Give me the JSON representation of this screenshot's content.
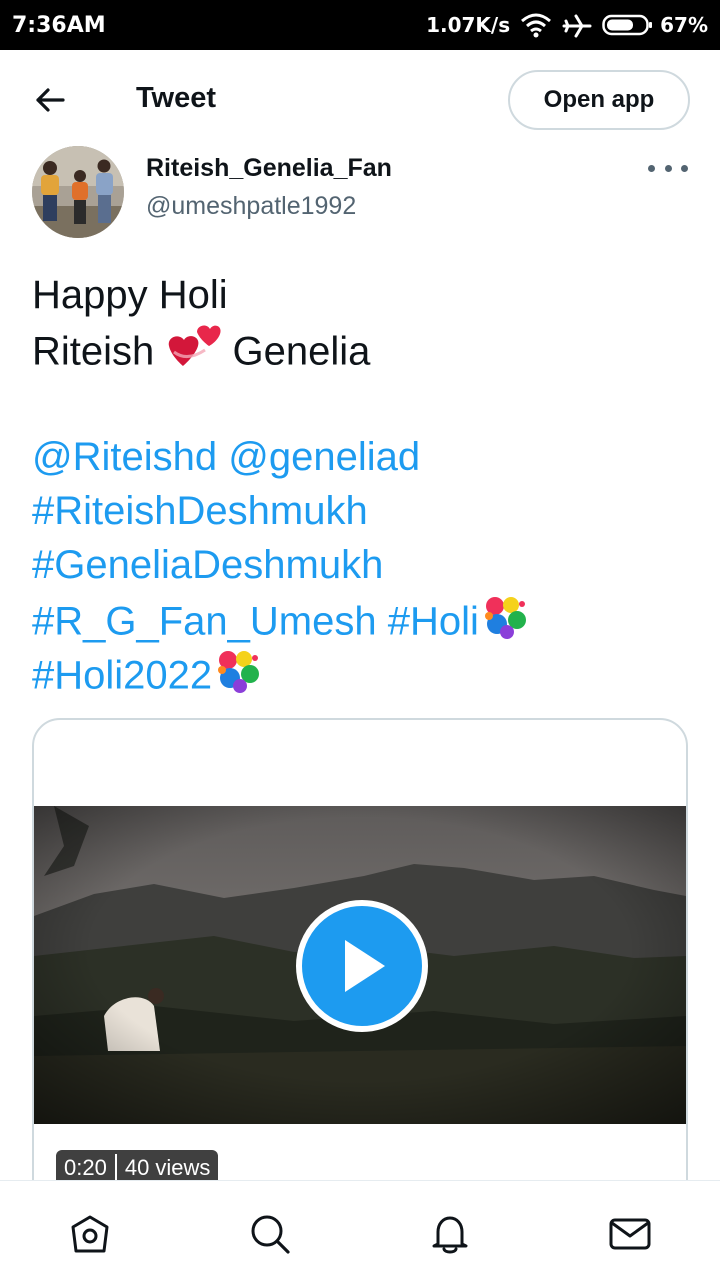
{
  "status_bar": {
    "time": "7:36AM",
    "network_speed": "1.07K/s",
    "battery": "67%",
    "battery_level": 0.67,
    "icons": [
      "wifi-icon",
      "airplane-icon",
      "battery-icon"
    ]
  },
  "header": {
    "title": "Tweet",
    "open_app_label": "Open app",
    "back_icon": "back-arrow-icon"
  },
  "author": {
    "name": "Riteish_Genelia_Fan",
    "handle": "@umeshpatle1992"
  },
  "tweet": {
    "line1": "Happy Holi",
    "line2a": "Riteish",
    "line2b": "Genelia",
    "mention1": "@Riteishd",
    "mention2": "@geneliad",
    "hashtag1": "#RiteishDeshmukh",
    "hashtag2": "#GeneliaDeshmukh",
    "hashtag3": "#R_G_Fan_Umesh",
    "hashtag4": "#Holi",
    "hashtag5": "#Holi2022"
  },
  "media": {
    "duration": "0:20",
    "views": "40 views"
  },
  "colors": {
    "link": "#1d9bf0",
    "text": "#0f1419",
    "muted": "#536471",
    "border": "#cfd9de"
  },
  "bottom_nav": [
    "home-icon",
    "search-icon",
    "notifications-icon",
    "messages-icon"
  ]
}
